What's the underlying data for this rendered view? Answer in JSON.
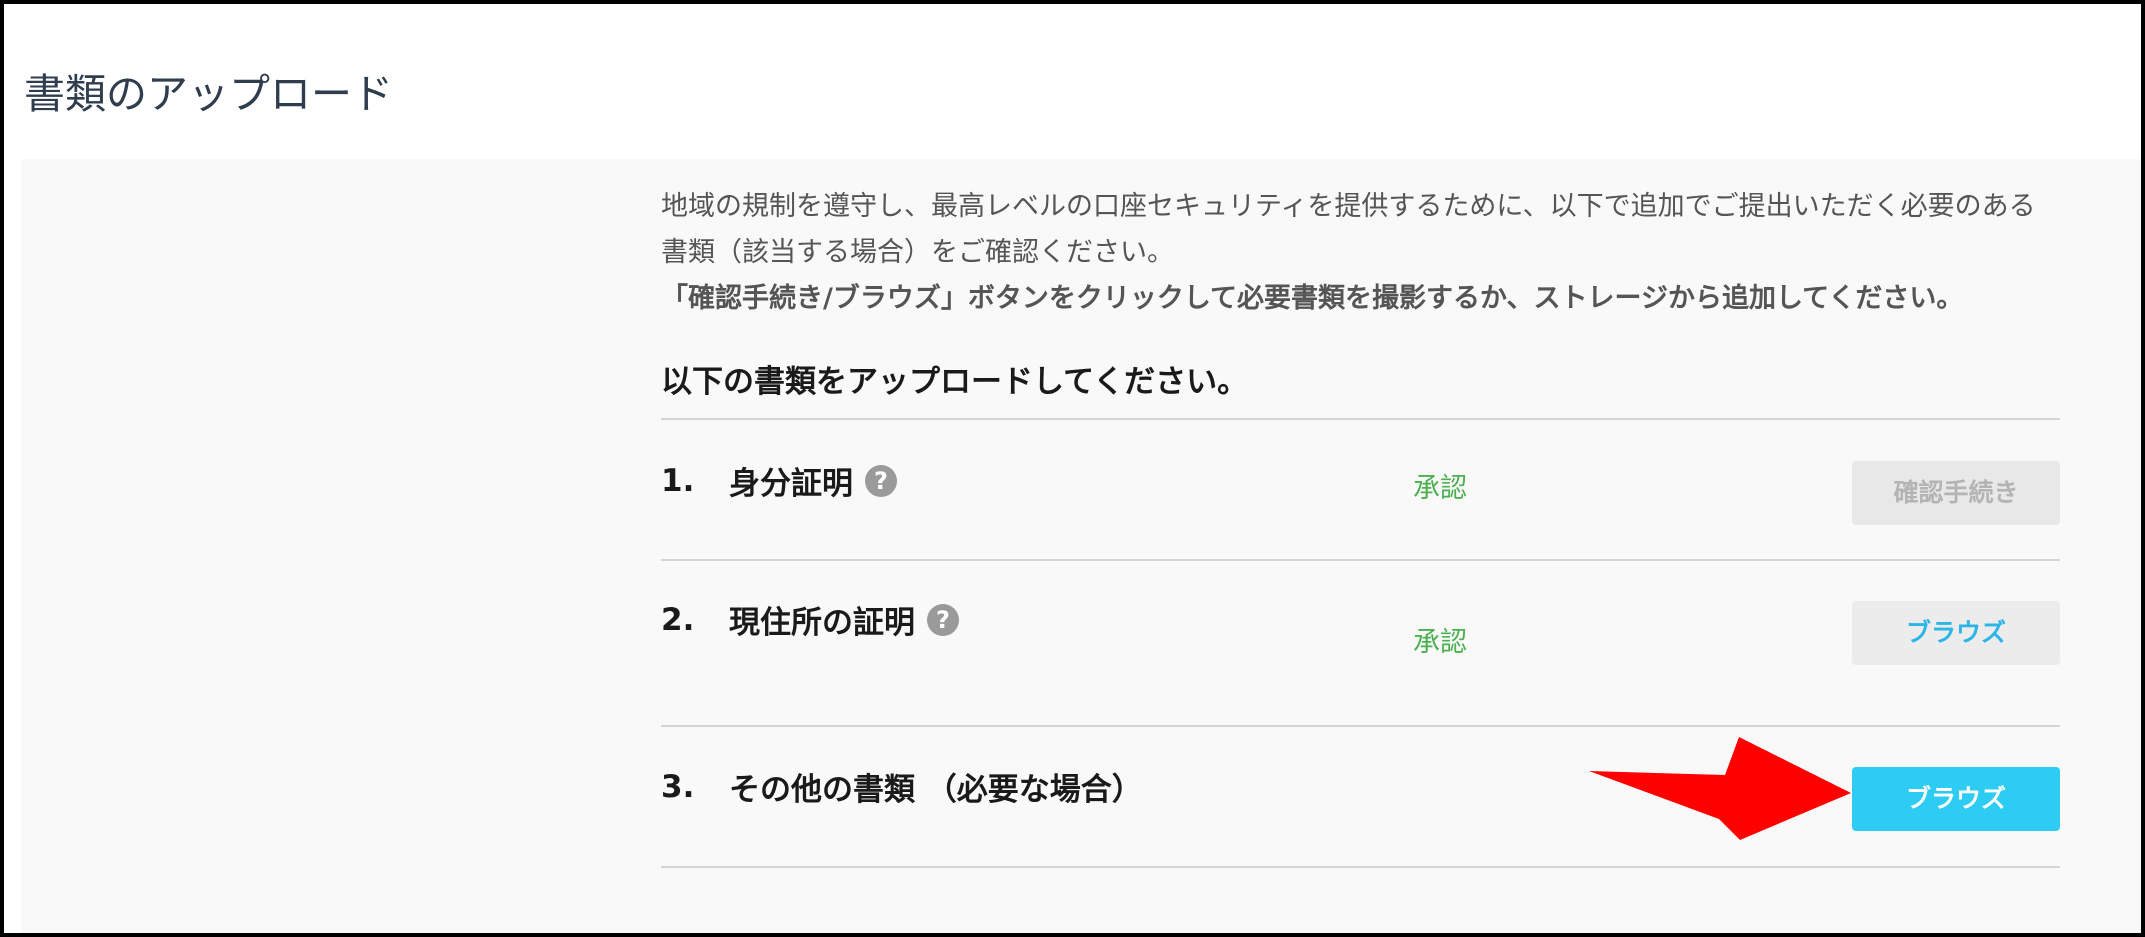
{
  "header": {
    "title": "書類のアップロード"
  },
  "intro": {
    "line1": "地域の規制を遵守し、最高レベルの口座セキュリティを提供するために、以下で追加でご提出いただく必要のある書類（該当する場合）をご確認ください。",
    "line2": "「確認手続き/ブラウズ」ボタンをクリックして必要書類を撮影するか、ストレージから追加してください。"
  },
  "section": {
    "heading": "以下の書類をアップロードしてください。"
  },
  "documents": [
    {
      "number": "1.",
      "title": "身分証明",
      "has_help": true,
      "status": "承認",
      "button_label": "確認手続き",
      "button_state": "disabled"
    },
    {
      "number": "2.",
      "title": "現住所の証明",
      "has_help": true,
      "status": "承認",
      "button_label": "ブラウズ",
      "button_state": "secondary"
    },
    {
      "number": "3.",
      "title": "その他の書類 （必要な場合）",
      "has_help": false,
      "status": "",
      "button_label": "ブラウズ",
      "button_state": "primary"
    }
  ],
  "help_icon_glyph": "?",
  "icons": {
    "help": "question-circle-icon",
    "annotation": "red-arrow-icon"
  },
  "colors": {
    "title": "#2f3d4f",
    "status_approved": "#4caf50",
    "primary_button": "#2ecbf2",
    "secondary_button_text": "#2cb6e8",
    "annotation_arrow": "#ff0000"
  }
}
